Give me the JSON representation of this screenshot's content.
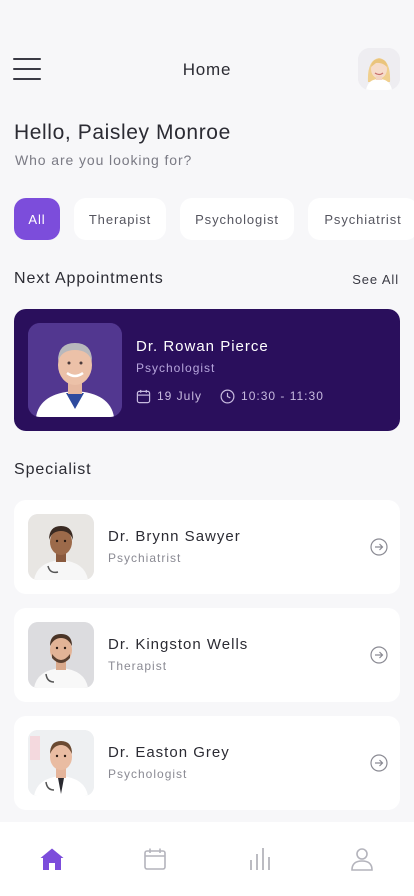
{
  "header": {
    "title": "Home",
    "menu_icon": "hamburger-menu-icon",
    "avatar_name": "user-avatar"
  },
  "greeting": {
    "title": "Hello, Paisley Monroe",
    "subtitle": "Who are you looking for?"
  },
  "categories": [
    {
      "label": "All",
      "selected": true
    },
    {
      "label": "Therapist",
      "selected": false
    },
    {
      "label": "Psychologist",
      "selected": false
    },
    {
      "label": "Psychiatrist",
      "selected": false
    }
  ],
  "appointments": {
    "heading": "Next Appointments",
    "see_all": "See All",
    "card": {
      "name": "Dr. Rowan Pierce",
      "specialty": "Psychologist",
      "date": "19 July",
      "time": "10:30 - 11:30"
    }
  },
  "specialist": {
    "heading": "Specialist",
    "doctors": [
      {
        "name": "Dr. Brynn Sawyer",
        "specialty": "Psychiatrist"
      },
      {
        "name": "Dr. Kingston Wells",
        "specialty": "Therapist"
      },
      {
        "name": "Dr. Easton Grey",
        "specialty": "Psychologist"
      }
    ]
  },
  "tabbar": {
    "items": [
      {
        "icon": "home-icon",
        "active": true
      },
      {
        "icon": "calendar-icon",
        "active": false
      },
      {
        "icon": "stats-icon",
        "active": false
      },
      {
        "icon": "profile-icon",
        "active": false
      }
    ]
  },
  "colors": {
    "accent": "#7c4ddb",
    "card_dark": "#2a0f5c",
    "background": "#f7f7f9"
  }
}
